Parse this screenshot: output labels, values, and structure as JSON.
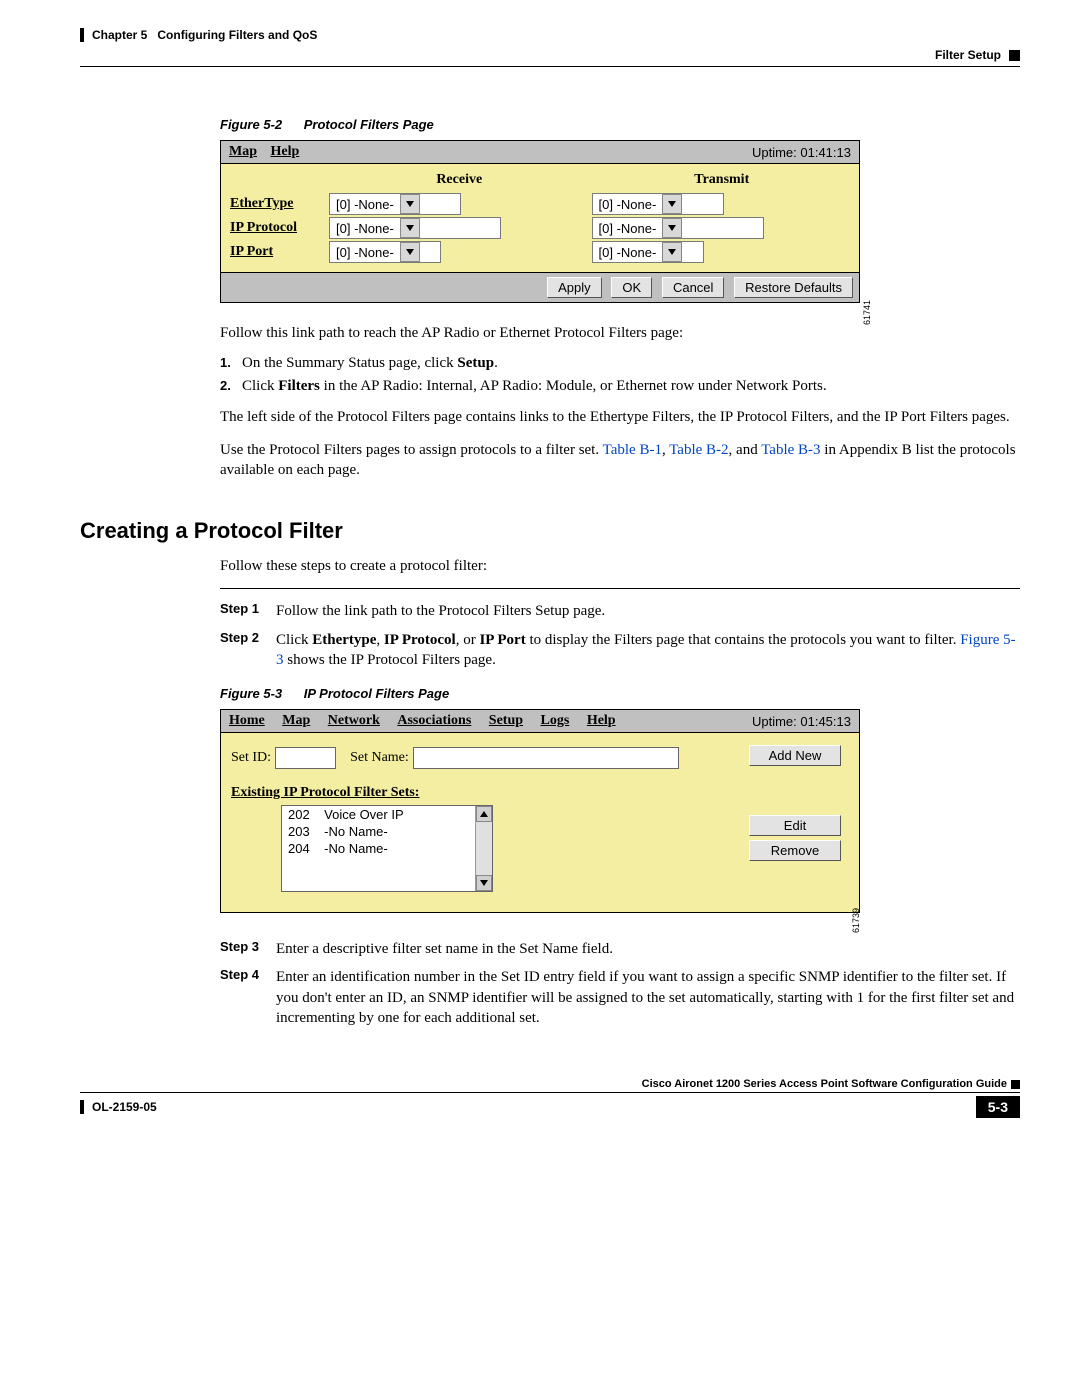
{
  "header": {
    "chapter": "Chapter 5",
    "title": "Configuring Filters and QoS",
    "section": "Filter Setup"
  },
  "fig52": {
    "caption_num": "Figure 5-2",
    "caption_title": "Protocol Filters Page",
    "menu": {
      "map": "Map",
      "help": "Help"
    },
    "uptime": "Uptime: 01:41:13",
    "col_receive": "Receive",
    "col_transmit": "Transmit",
    "rows": {
      "ethertype": {
        "label": "EtherType",
        "recv": "[0]  -None-",
        "tx": "[0]  -None-"
      },
      "ipproto": {
        "label": "IP Protocol",
        "recv": "[0]  -None-",
        "tx": "[0]  -None-"
      },
      "ipport": {
        "label": "IP Port",
        "recv": "[0]  -None-",
        "tx": "[0]  -None-"
      }
    },
    "buttons": {
      "apply": "Apply",
      "ok": "OK",
      "cancel": "Cancel",
      "restore": "Restore Defaults"
    },
    "imgid": "61741"
  },
  "body": {
    "p1": "Follow this link path to reach the AP Radio or Ethernet Protocol Filters page:",
    "li1_pre": "On the Summary Status page, click ",
    "li1_b": "Setup",
    "li1_post": ".",
    "li2_pre": "Click ",
    "li2_b": "Filters",
    "li2_post": " in the AP Radio: Internal, AP Radio: Module, or Ethernet row under Network Ports.",
    "p2": "The left side of the Protocol Filters page contains links to the Ethertype Filters, the IP Protocol Filters, and the IP Port Filters pages.",
    "p3_pre": "Use the Protocol Filters pages to assign protocols to a filter set. ",
    "p3_l1": "Table B-1",
    "p3_c1": ", ",
    "p3_l2": "Table B-2",
    "p3_c2": ", and ",
    "p3_l3": "Table B-3",
    "p3_post": " in Appendix B list the protocols available on each page."
  },
  "section2": {
    "heading": "Creating a Protocol Filter",
    "intro": "Follow these steps to create a protocol filter:",
    "step1_lbl": "Step 1",
    "step1_txt": "Follow the link path to the Protocol Filters Setup page.",
    "step2_lbl": "Step 2",
    "step2_pre": "Click ",
    "step2_b1": "Ethertype",
    "step2_c1": ", ",
    "step2_b2": "IP Protocol",
    "step2_c2": ", or ",
    "step2_b3": "IP Port",
    "step2_mid": " to display the Filters page that contains the protocols you want to filter. ",
    "step2_link": "Figure 5-3",
    "step2_post": " shows the IP Protocol Filters page.",
    "step3_lbl": "Step 3",
    "step3_txt": "Enter a descriptive filter set name in the Set Name field.",
    "step4_lbl": "Step 4",
    "step4_txt": "Enter an identification number in the Set ID entry field if you want to assign a specific SNMP identifier to the filter set. If you don't enter an ID, an SNMP identifier will be assigned to the set automatically, starting with 1 for the first filter set and incrementing by one for each additional set."
  },
  "fig53": {
    "caption_num": "Figure 5-3",
    "caption_title": "IP Protocol Filters Page",
    "menu": {
      "home": "Home",
      "map": "Map",
      "network": "Network",
      "assoc": "Associations",
      "setup": "Setup",
      "logs": "Logs",
      "help": "Help"
    },
    "uptime": "Uptime: 01:45:13",
    "setid_lbl": "Set ID:",
    "setname_lbl": "Set Name:",
    "addnew": "Add New",
    "existing_h": "Existing IP Protocol Filter Sets:",
    "items": [
      {
        "id": "202",
        "name": "Voice Over IP"
      },
      {
        "id": "203",
        "name": "-No Name-"
      },
      {
        "id": "204",
        "name": "-No Name-"
      }
    ],
    "edit": "Edit",
    "remove": "Remove",
    "imgid": "61739"
  },
  "footer": {
    "book": "Cisco Aironet 1200 Series Access Point Software Configuration Guide",
    "docid": "OL-2159-05",
    "page": "5-3"
  }
}
